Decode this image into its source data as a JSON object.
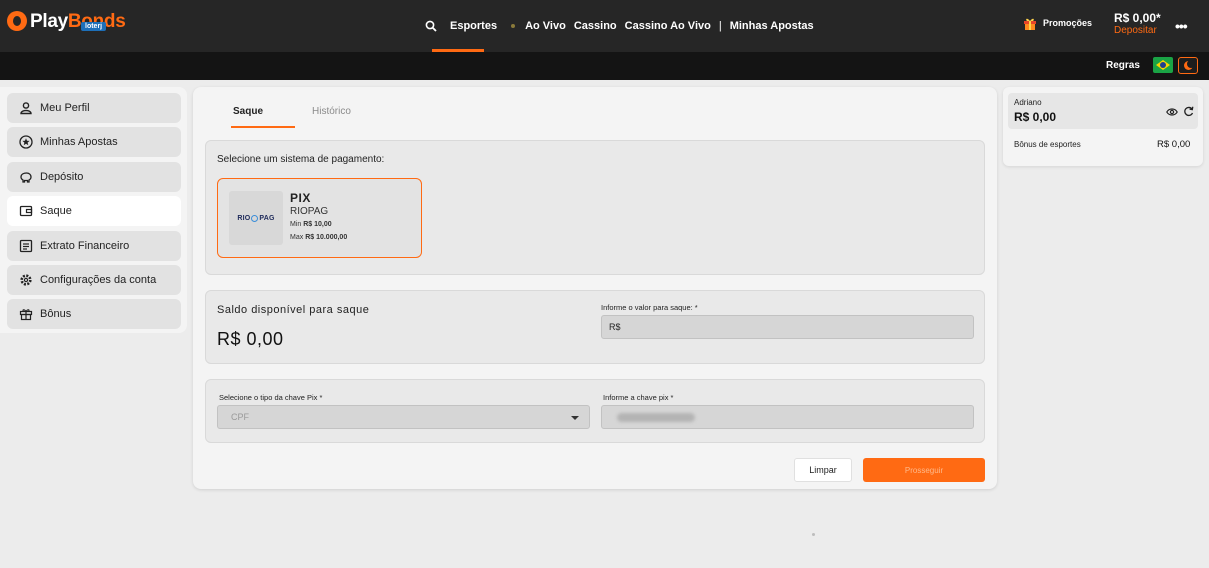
{
  "header": {
    "logo_play": "Play",
    "logo_bonds": "Bonds",
    "logo_badge": "loterj",
    "nav": [
      "Esportes",
      "Ao Vivo",
      "Cassino",
      "Cassino Ao Vivo",
      "|",
      "Minhas Apostas"
    ],
    "promotions": "Promoções",
    "balance": "R$ 0,00*",
    "deposit": "Depositar",
    "more": "•••"
  },
  "subbar": {
    "rules": "Regras"
  },
  "sidebar": {
    "items": [
      {
        "label": "Meu Perfil",
        "icon": "user-icon"
      },
      {
        "label": "Minhas Apostas",
        "icon": "star-circle-icon"
      },
      {
        "label": "Depósito",
        "icon": "piggy-bank-icon"
      },
      {
        "label": "Saque",
        "icon": "wallet-icon"
      },
      {
        "label": "Extrato Financeiro",
        "icon": "statement-icon"
      },
      {
        "label": "Configurações da conta",
        "icon": "gear-icon"
      },
      {
        "label": "Bônus",
        "icon": "gift-icon"
      }
    ],
    "active": "Saque"
  },
  "main": {
    "tabs": [
      "Saque",
      "Histórico"
    ],
    "payment": {
      "title": "Selecione um sistema de pagamento:",
      "logo_text_left": "RIO",
      "logo_text_right": "PAG",
      "method_name": "PIX",
      "provider": "RIOPAG",
      "min_prefix": "Min",
      "min_value": "R$ 10,00",
      "max_prefix": "Max",
      "max_value": "R$ 10.000,00"
    },
    "withdraw": {
      "balance_label": "Saldo disponível para saque",
      "balance_value": "R$ 0,00",
      "amount_label": "Informe o valor para saque: *",
      "amount_prefix": "R$"
    },
    "pix": {
      "type_label": "Selecione o tipo da chave Pix *",
      "type_value": "CPF",
      "key_label": "Informe a chave pix *"
    },
    "buttons": {
      "clear": "Limpar",
      "proceed": "Prosseguir"
    }
  },
  "wallet": {
    "name": "Adriano",
    "balance": "R$ 0,00",
    "bonus_label": "Bônus de esportes",
    "bonus_value": "R$ 0,00"
  },
  "colors": {
    "accent": "#ff6a13",
    "header_bg": "#262626",
    "subbar_bg": "#141414"
  }
}
